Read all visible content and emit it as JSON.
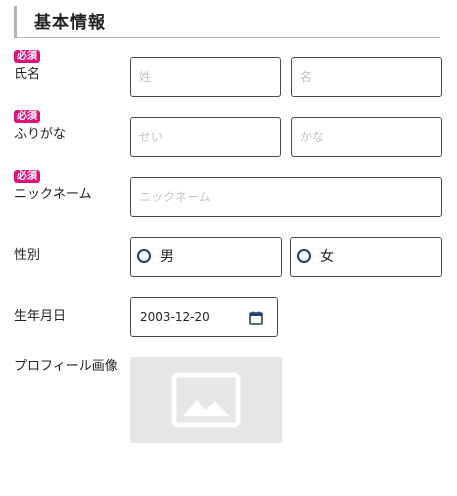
{
  "section": {
    "title": "基本情報"
  },
  "required_badge": "必須",
  "fields": {
    "name": {
      "label": "氏名",
      "last_placeholder": "姓",
      "first_placeholder": "名"
    },
    "kana": {
      "label": "ふりがな",
      "last_placeholder": "せい",
      "first_placeholder": "かな"
    },
    "nickname": {
      "label": "ニックネーム",
      "placeholder": "ニックネーム"
    },
    "gender": {
      "label": "性別",
      "options": [
        "男",
        "女"
      ]
    },
    "birthday": {
      "label": "生年月日",
      "value": "2003-12-20"
    },
    "profile_image": {
      "label": "プロフィール画像"
    }
  },
  "icons": {
    "radio": "radio-circle",
    "calendar": "calendar-icon",
    "image": "image-icon"
  },
  "colors": {
    "badge": "#e0127a",
    "border": "#4a4a4a",
    "radio": "#1f3f6d",
    "placeholder": "#c4c4c4",
    "image_placeholder_bg": "#e6e6e6"
  }
}
